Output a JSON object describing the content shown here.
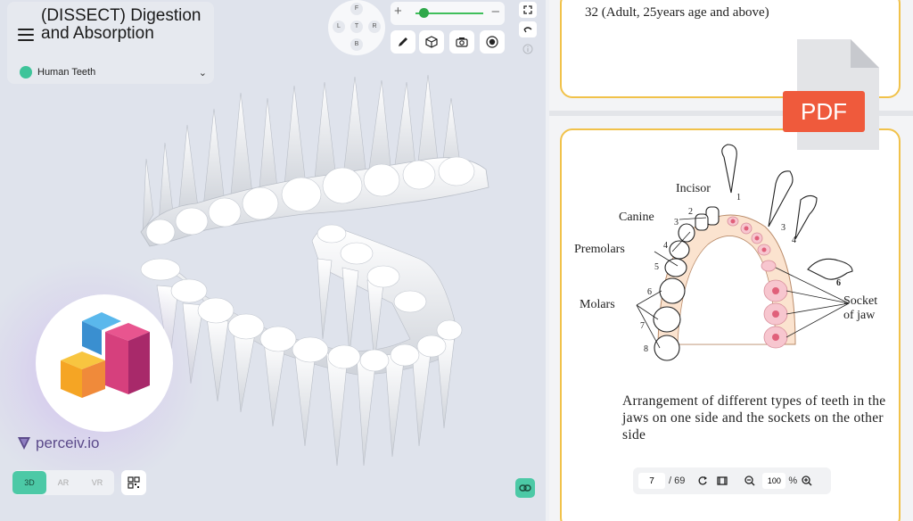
{
  "header": {
    "title": "(DISSECT) Digestion and Absorption",
    "model_name": "Human Teeth",
    "model_color": "#3ec49a"
  },
  "compass": {
    "front": "F",
    "back": "B",
    "left": "L",
    "top": "T",
    "right": "R"
  },
  "zoom": {
    "plus": "+",
    "minus": "–",
    "level": 0.1
  },
  "tools": [
    "pencil-icon",
    "cube-icon",
    "camera-icon",
    "record-icon"
  ],
  "brand": {
    "name": "perceiv.io"
  },
  "modes": {
    "three_d": "3D",
    "ar": "AR",
    "vr": "VR",
    "active": "3D"
  },
  "pdf_badge": "PDF",
  "card1": {
    "text": "32 (Adult, 25years age and above)"
  },
  "diagram": {
    "labels": {
      "incisor": "Incisor",
      "canine": "Canine",
      "premolars": "Premolars",
      "molars": "Molars",
      "socket_line1": "Socket",
      "socket_line2": "of jaw"
    },
    "numbers": [
      "1",
      "2",
      "3",
      "4",
      "5",
      "6",
      "7",
      "8",
      "1",
      "3",
      "4",
      "6"
    ]
  },
  "caption": "Arrangement of different types of teeth in the jaws on one side and the sockets on the other side",
  "pdf_toolbar": {
    "page": "7",
    "total": "/ 69",
    "zoom": "100",
    "percent": "%"
  },
  "colors": {
    "accent": "#4cc9a6",
    "card_border": "#f1c24a",
    "pdf_red": "#ef5a3c"
  }
}
